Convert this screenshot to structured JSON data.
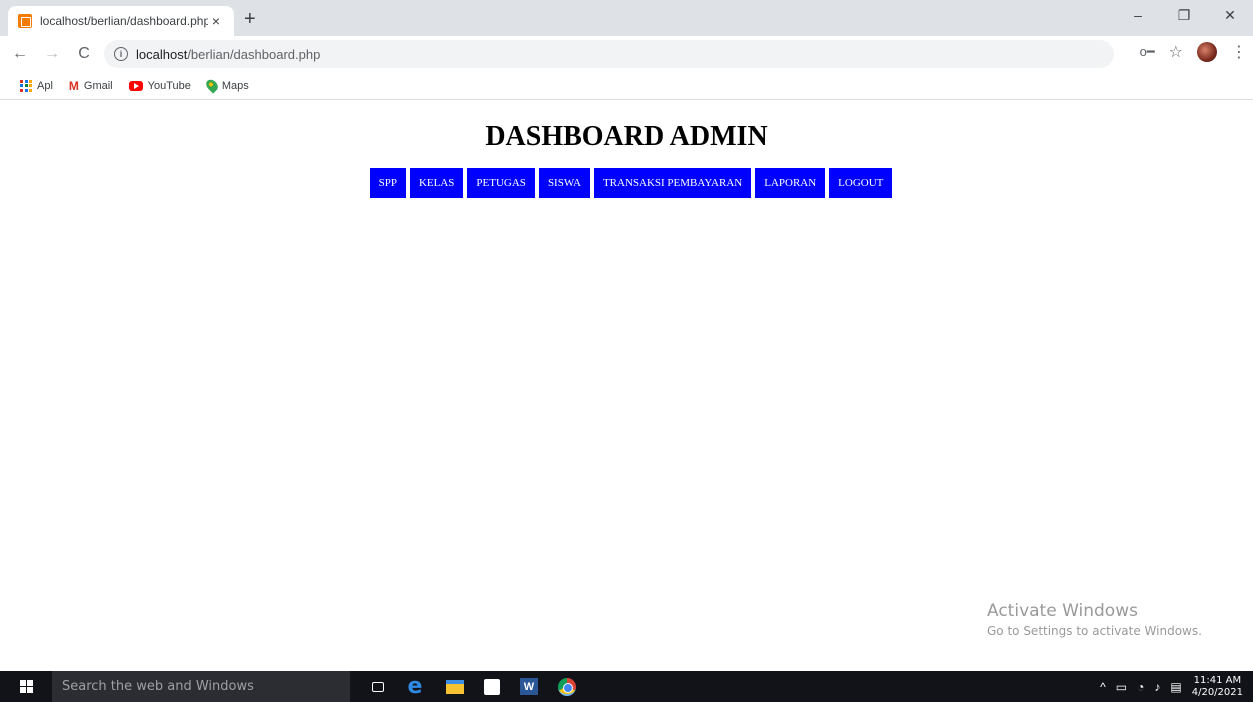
{
  "browser": {
    "tab_title": "localhost/berlian/dashboard.php",
    "tab_close": "×",
    "new_tab": "+",
    "url_host": "localhost",
    "url_path": "/berlian/dashboard.php",
    "window_controls": [
      "–",
      "❐",
      "✕"
    ],
    "nav": {
      "back": "←",
      "forward": "→",
      "reload": "C"
    },
    "bookmarks": [
      {
        "label": "Apl",
        "icon": "apps-icon"
      },
      {
        "label": "Gmail",
        "icon": "gmail-icon"
      },
      {
        "label": "YouTube",
        "icon": "youtube-icon"
      },
      {
        "label": "Maps",
        "icon": "maps-icon"
      }
    ]
  },
  "page": {
    "title": "DASHBOARD ADMIN",
    "menu": [
      "SPP",
      "KELAS",
      "PETUGAS",
      "SISWA",
      "TRANSAKSI PEMBAYARAN",
      "LAPORAN",
      "LOGOUT"
    ],
    "menu_color": "#0000ff"
  },
  "watermark": {
    "title": "Activate Windows",
    "subtitle": "Go to Settings to activate Windows."
  },
  "taskbar": {
    "search_placeholder": "Search the web and Windows",
    "time": "11:41 AM",
    "date": "4/20/2021",
    "tray_icons": [
      "chevron-up-icon",
      "battery-icon",
      "wifi-icon",
      "volume-icon",
      "notification-icon"
    ]
  }
}
